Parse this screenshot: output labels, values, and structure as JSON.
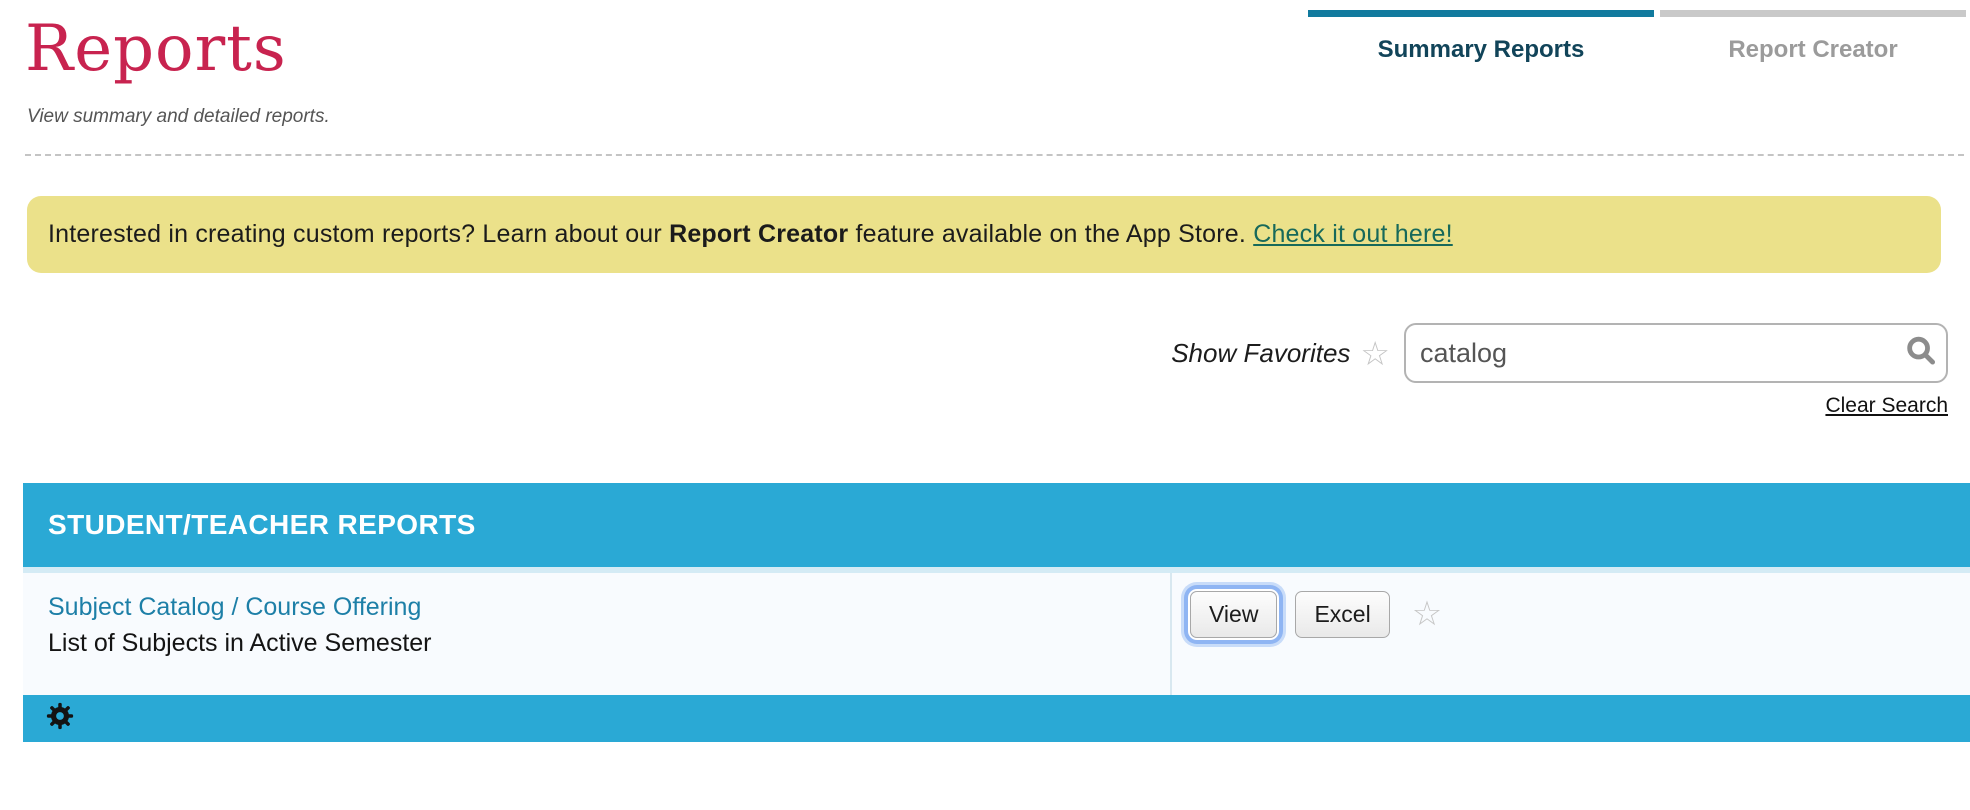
{
  "page": {
    "title": "Reports",
    "subtitle": "View summary and detailed reports."
  },
  "tabs": [
    {
      "label": "Summary Reports",
      "active": true
    },
    {
      "label": "Report Creator",
      "active": false
    }
  ],
  "banner": {
    "text_before": "Interested in creating custom reports? Learn about our ",
    "bold_text": "Report Creator",
    "text_after": " feature available on the App Store. ",
    "link_label": "Check it out here!"
  },
  "search": {
    "favorites_label": "Show Favorites",
    "favorites_star_icon": "star-outline",
    "star_glyph": "☆",
    "value": "catalog",
    "search_icon": "magnifier",
    "clear_label": "Clear Search"
  },
  "table": {
    "header": "STUDENT/TEACHER REPORTS",
    "rows": [
      {
        "title": "Subject Catalog / Course Offering",
        "description": "List of Subjects in Active Semester",
        "actions": [
          {
            "label": "View",
            "focused": true
          },
          {
            "label": "Excel",
            "focused": false
          }
        ],
        "favorite_star_icon": "star-outline",
        "star_glyph": "☆"
      }
    ],
    "footer_icon": "gear"
  },
  "colors": {
    "title_pink": "#c8234f",
    "tab_active_text": "#114459",
    "tab_bar_active": "#117a9e",
    "tab_bar_inactive": "#c9c9c9",
    "tab_inactive_text": "#9b9b9b",
    "banner_bg": "#ebe18a",
    "banner_link": "#17695a",
    "table_header_bg": "#2aa9d5",
    "row_bg": "#f8fbfe",
    "row_link": "#1d7fa7",
    "focus_ring": "#8fb5f3"
  }
}
